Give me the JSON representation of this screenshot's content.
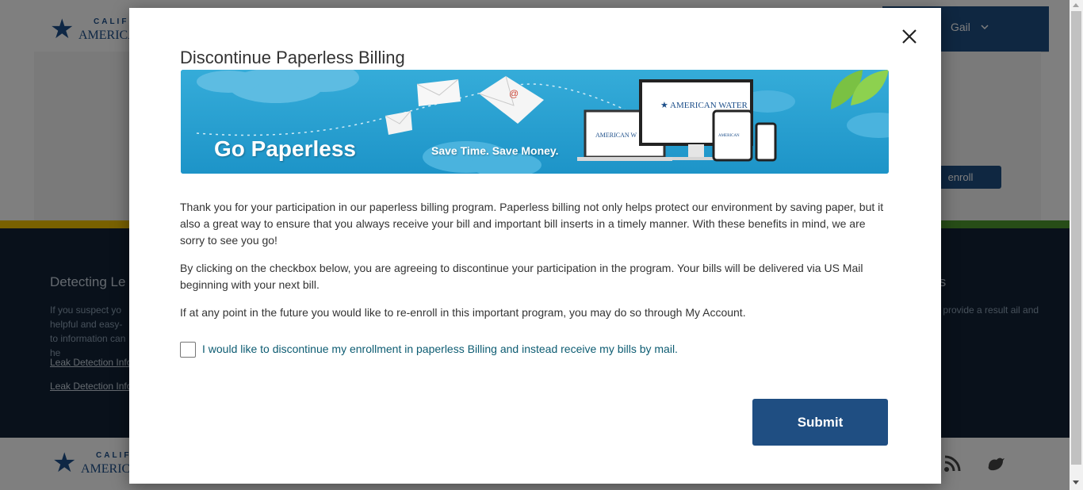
{
  "background": {
    "header": {
      "logo_top": "CALIF",
      "logo_main": "AMERICA",
      "user_name": "Gail"
    },
    "enroll_button_label": "enroll",
    "footer": {
      "heading": "Detecting Le",
      "text": "If you suspect yo helpful and easy-to information can he",
      "link1": "Leak Detection Info",
      "link2": "Leak Detection Info",
      "right_heading": "ts",
      "right_text": "y provide a result ail and"
    }
  },
  "modal": {
    "title": "Discontinue Paperless Billing",
    "banner": {
      "title": "Go Paperless",
      "subtitle": "Save Time. Save Money.",
      "brand": "AMERICAN WATER",
      "brand_small": "AMERICAN W"
    },
    "paragraphs": [
      "Thank you for your participation in our paperless billing program. Paperless billing not only helps protect our environment by saving paper, but it also a great way to ensure that you always receive your bill and important bill inserts in a timely manner. With these benefits in mind, we are sorry to see you go!",
      "By clicking on the checkbox below, you are agreeing to discontinue your participation in the program. Your bills will be delivered via US Mail beginning with your next bill.",
      "If at any point in the future you would like to re-enroll in this important program, you may do so through My Account."
    ],
    "checkbox_label": "I would like to discontinue my enrollment in paperless Billing and instead receive my bills by mail.",
    "checkbox_checked": false,
    "submit_label": "Submit"
  },
  "colors": {
    "primary": "#1f4e82",
    "banner": "#2ba3d4",
    "footer_dark": "#122336",
    "link_teal": "#0d5c72"
  }
}
